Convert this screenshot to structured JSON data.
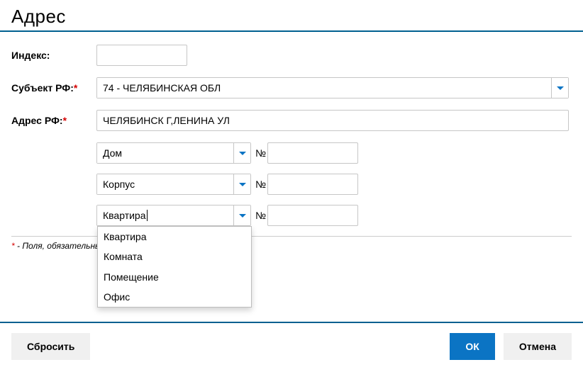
{
  "title": "Адрес",
  "labels": {
    "index": "Индекс:",
    "subject": "Субъект РФ:",
    "address": "Адрес РФ:",
    "num": "№"
  },
  "values": {
    "subject": "74 - ЧЕЛЯБИНСКАЯ ОБЛ",
    "address": "ЧЕЛЯБИНСК Г,ЛЕНИНА УЛ",
    "sel1": "Дом",
    "sel2": "Корпус",
    "sel3": "Квартира"
  },
  "dropdown": {
    "opt1": "Квартира",
    "opt2": "Комната",
    "opt3": "Помещение",
    "opt4": "Офис"
  },
  "footnote_star": "*",
  "footnote_text": " - Поля, обязательны",
  "buttons": {
    "reset": "Сбросить",
    "ok": "ОК",
    "cancel": "Отмена"
  }
}
